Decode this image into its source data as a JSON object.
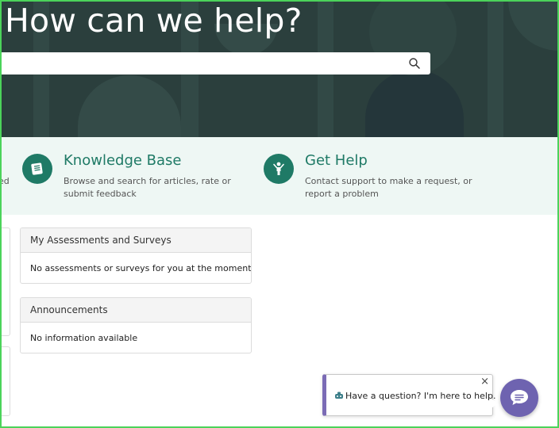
{
  "hero": {
    "title": "How can we help?",
    "search_placeholder": ""
  },
  "cards": {
    "partial_left_text": "ed",
    "items": [
      {
        "title": "Knowledge Base",
        "description": "Browse and search for articles, rate or submit feedback",
        "icon": "book-icon"
      },
      {
        "title": "Get Help",
        "description": "Contact support to make a request, or report a problem",
        "icon": "person-icon"
      }
    ]
  },
  "panels": [
    {
      "title": "My Assessments and Surveys",
      "body": "No assessments or surveys for you at the moment"
    },
    {
      "title": "Announcements",
      "body": "No information available"
    }
  ],
  "chat": {
    "prompt": "Have a question? I'm here to help.",
    "close_symbol": "×",
    "launcher_icon": "chat-bubble-icon"
  },
  "colors": {
    "hero_bg": "#2b3f3d",
    "accent": "#1f7a66",
    "band_bg": "#eef7f4",
    "chat_accent": "#6e63b0"
  }
}
